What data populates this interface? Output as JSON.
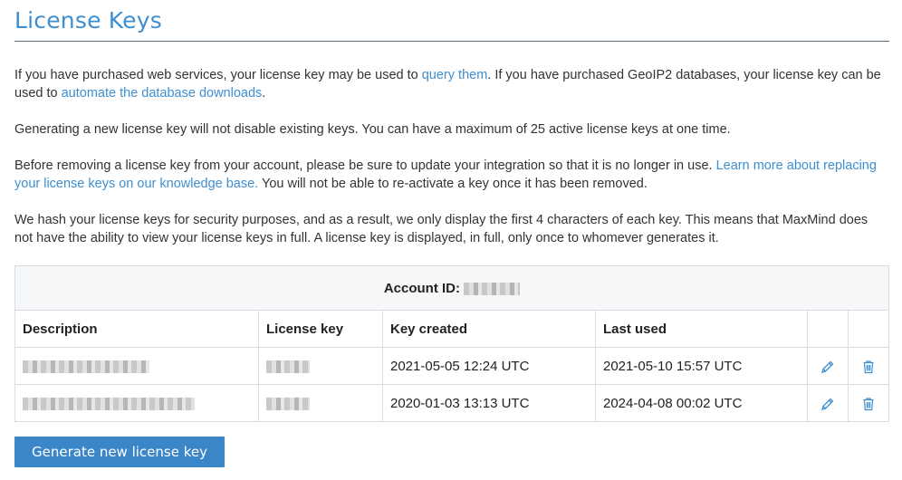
{
  "page": {
    "title": "License Keys"
  },
  "intro": {
    "p1_before_link1": "If you have purchased web services, your license key may be used to ",
    "link1": "query them",
    "p1_middle": ". If you have purchased GeoIP2 databases, your license key can be used to ",
    "link2": "automate the database downloads",
    "p1_end": ".",
    "p2": "Generating a new license key will not disable existing keys. You can have a maximum of 25 active license keys at one time.",
    "p3_before_link": "Before removing a license key from your account, please be sure to update your integration so that it is no longer in use. ",
    "p3_link": "Learn more about replacing your license keys on our knowledge base.",
    "p3_after_link": " You will not be able to re-activate a key once it has been removed.",
    "p4": "We hash your license keys for security purposes, and as a result, we only display the first 4 characters of each key. This means that MaxMind does not have the ability to view your license keys in full. A license key is displayed, in full, only once to whomever generates it."
  },
  "table": {
    "account_label": "Account ID:",
    "columns": [
      "Description",
      "License key",
      "Key created",
      "Last used"
    ],
    "rows": [
      {
        "key_created": "2021-05-05 12:24 UTC",
        "last_used": "2021-05-10 15:57 UTC"
      },
      {
        "key_created": "2020-01-03 13:13 UTC",
        "last_used": "2024-04-08 00:02 UTC"
      }
    ]
  },
  "icons": {
    "edit": "pencil-icon",
    "delete": "trash-icon"
  },
  "colors": {
    "accent": "#3d8fd1",
    "button": "#3a86c8"
  },
  "actions": {
    "generate_label": "Generate new license key"
  }
}
